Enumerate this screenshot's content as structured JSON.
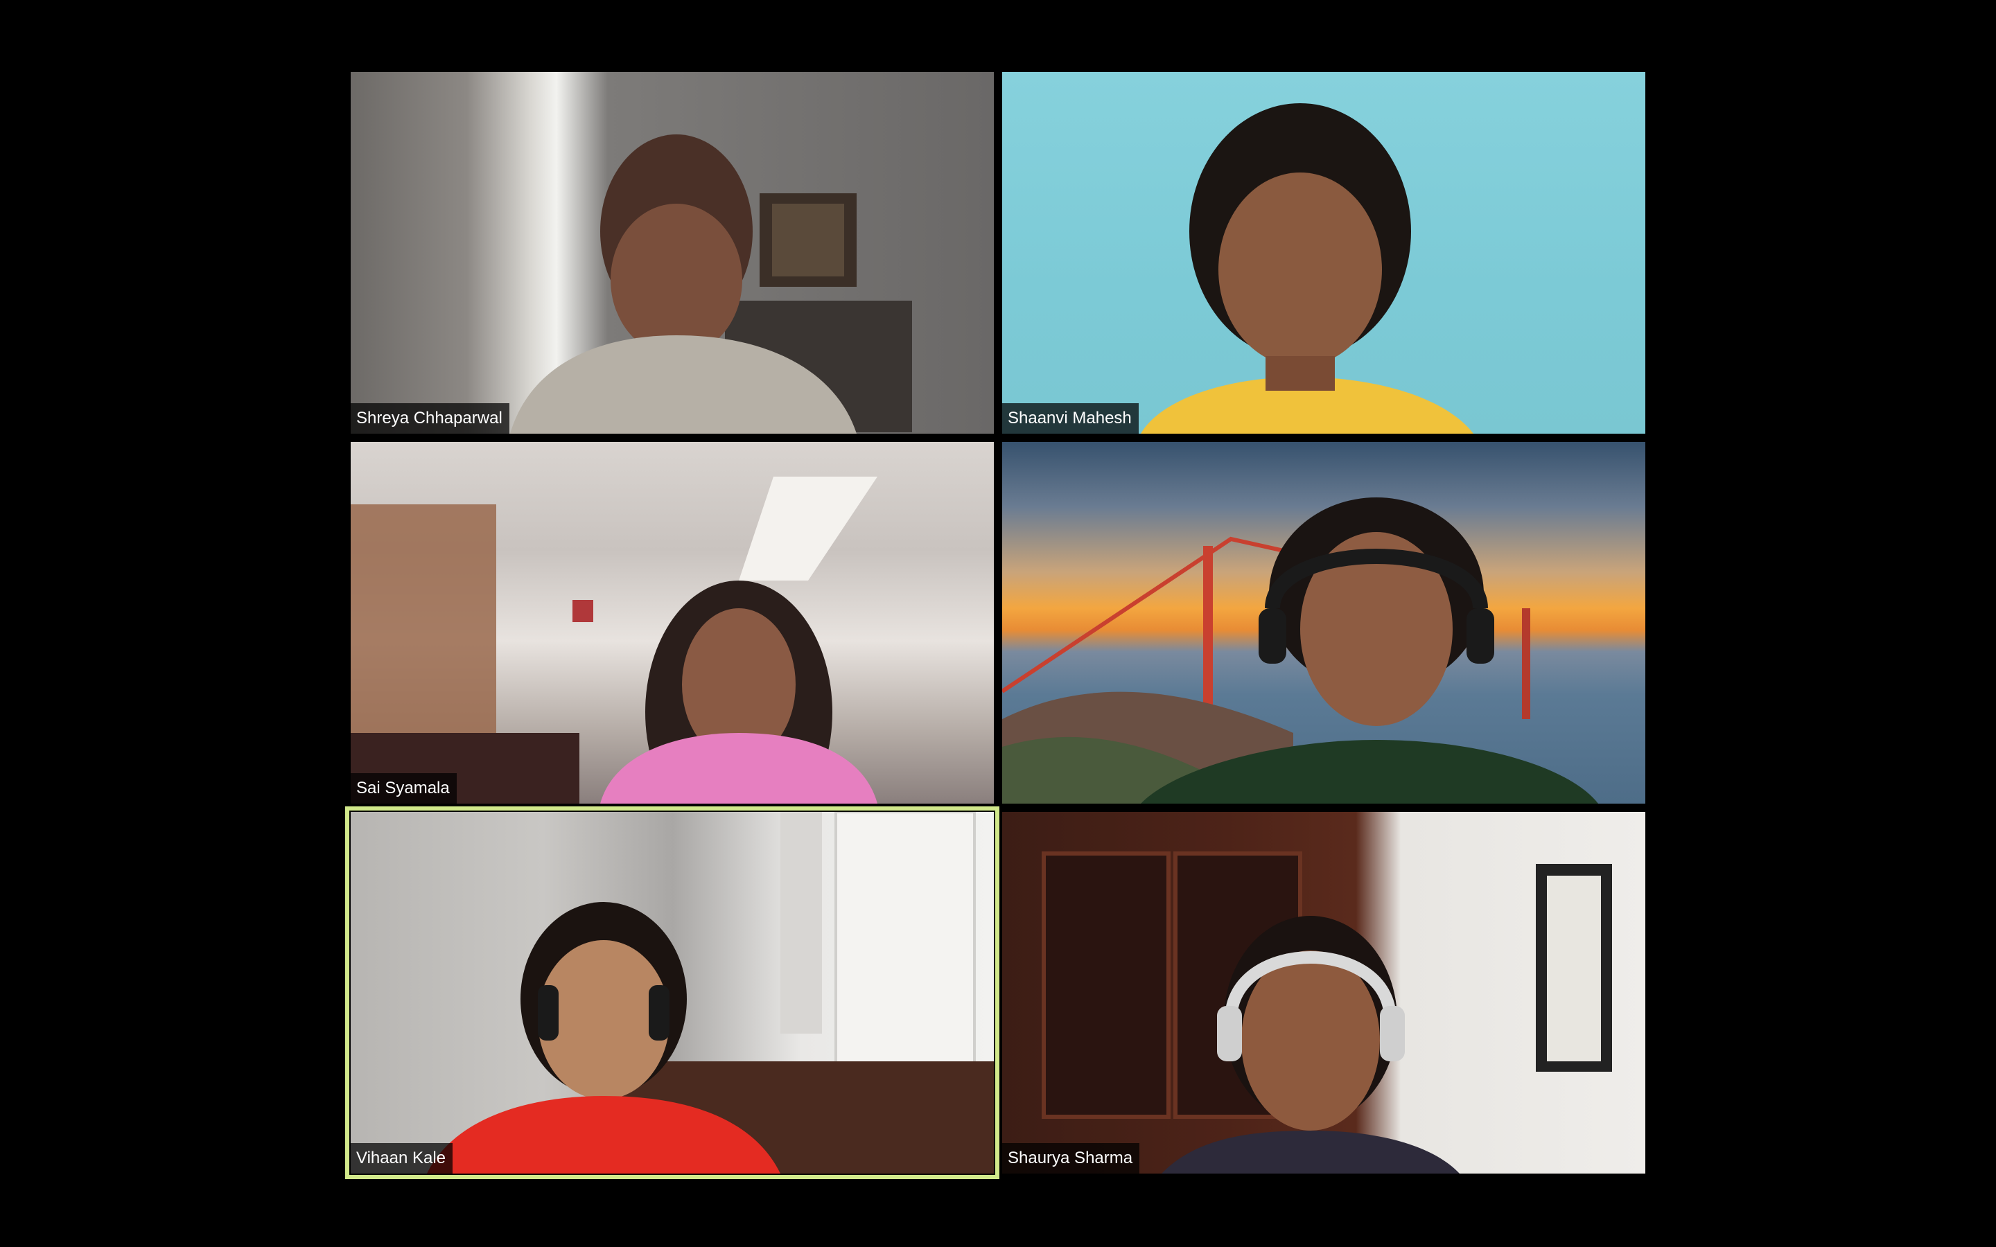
{
  "meeting": {
    "layout": "gallery",
    "active_speaker_color": "#d2e98b"
  },
  "participants": [
    {
      "name": "Shreya Chhaparwal",
      "active": false
    },
    {
      "name": "Shaanvi Mahesh",
      "active": false
    },
    {
      "name": "Sai Syamala",
      "active": false
    },
    {
      "name": "",
      "active": false
    },
    {
      "name": "Vihaan Kale",
      "active": true
    },
    {
      "name": "Shaurya Sharma",
      "active": false
    }
  ]
}
